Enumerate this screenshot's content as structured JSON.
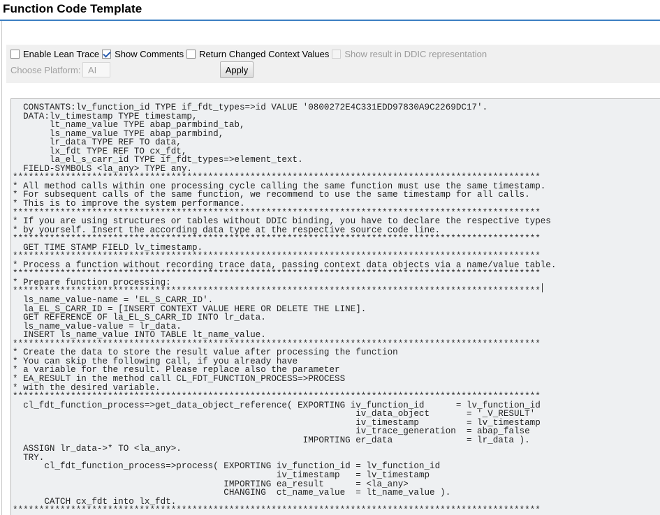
{
  "header": {
    "title": "Function Code Template"
  },
  "options": {
    "lean_trace": {
      "label": "Enable Lean Trace",
      "checked": false
    },
    "show_comments": {
      "label": "Show Comments",
      "checked": true
    },
    "return_changed": {
      "label": "Return Changed Context Values",
      "checked": false
    },
    "ddic_repr": {
      "label": "Show result in DDIC representation",
      "checked": false,
      "disabled": true
    },
    "platform_label": "Choose Platform:",
    "platform_value": "AI",
    "apply_label": "Apply"
  },
  "code": [
    "  CONSTANTS:lv_function_id TYPE if_fdt_types=>id VALUE '0800272E4C331EDD97830A9C2269DC17'.",
    "  DATA:lv_timestamp TYPE timestamp,",
    "       lt_name_value TYPE abap_parmbind_tab,",
    "       ls_name_value TYPE abap_parmbind,",
    "       lr_data TYPE REF TO data,",
    "       lx_fdt TYPE REF TO cx_fdt,",
    "       la_el_s_carr_id TYPE if_fdt_types=>element_text.",
    "  FIELD-SYMBOLS <la_any> TYPE any.",
    "****************************************************************************************************",
    "* All method calls within one processing cycle calling the same function must use the same timestamp.",
    "* For subsequent calls of the same function, we recommend to use the same timestamp for all calls.",
    "* This is to improve the system performance.",
    "****************************************************************************************************",
    "* If you are using structures or tables without DDIC binding, you have to declare the respective types",
    "* by yourself. Insert the according data type at the respective source code line.",
    "****************************************************************************************************",
    "  GET TIME STAMP FIELD lv_timestamp.",
    "****************************************************************************************************",
    "* Process a function without recording trace data, passing context data objects via a name/value table.",
    "****************************************************************************************************",
    "* Prepare function processing:",
    "****************************************************************************************************",
    "  ls_name_value-name = 'EL_S_CARR_ID'.",
    "  la_EL_S_CARR_ID = [INSERT CONTEXT VALUE HERE OR DELETE THE LINE].",
    "  GET REFERENCE OF la_EL_S_CARR_ID INTO lr_data.",
    "  ls_name_value-value = lr_data.",
    "  INSERT ls_name_value INTO TABLE lt_name_value.",
    "****************************************************************************************************",
    "* Create the data to store the result value after processing the function",
    "* You can skip the following call, if you already have",
    "* a variable for the result. Please replace also the parameter",
    "* EA_RESULT in the method call CL_FDT_FUNCTION_PROCESS=>PROCESS",
    "* with the desired variable.",
    "****************************************************************************************************",
    "  cl_fdt_function_process=>get_data_object_reference( EXPORTING iv_function_id      = lv_function_id",
    "                                                                 iv_data_object       = '_V_RESULT'",
    "                                                                 iv_timestamp         = lv_timestamp",
    "                                                                 iv_trace_generation  = abap_false",
    "                                                       IMPORTING er_data              = lr_data ).",
    "  ASSIGN lr_data->* TO <la_any>.",
    "  TRY.",
    "      cl_fdt_function_process=>process( EXPORTING iv_function_id = lv_function_id",
    "                                                  iv_timestamp   = lv_timestamp",
    "                                        IMPORTING ea_result      = <la_any>",
    "                                        CHANGING  ct_name_value  = lt_name_value ).",
    "      CATCH cx_fdt into lx_fdt.",
    "****************************************************************************************************"
  ]
}
